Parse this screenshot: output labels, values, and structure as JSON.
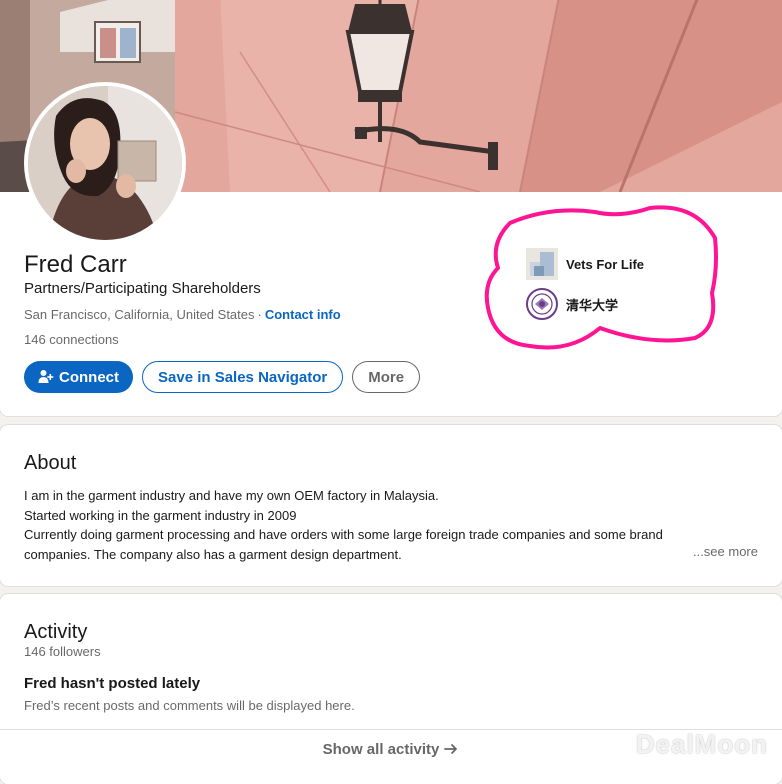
{
  "profile": {
    "name": "Fred Carr",
    "headline": "Partners/Participating Shareholders",
    "location": "San Francisco, California, United States",
    "separator": "·",
    "contact_info": "Contact info",
    "connections": "146 connections"
  },
  "actions": {
    "connect": "Connect",
    "save_sales_navigator": "Save in Sales Navigator",
    "more": "More"
  },
  "orgs": [
    {
      "name": "Vets For Life",
      "icon": "company-logo-icon"
    },
    {
      "name": "清华大学",
      "icon": "university-seal-icon"
    }
  ],
  "about": {
    "title": "About",
    "lines": [
      "I am in the garment industry and have my own OEM factory in Malaysia.",
      "Started working in the garment industry in 2009",
      "Currently doing garment processing and have orders with some large foreign trade companies and some brand",
      "companies. The company also has a garment design department."
    ],
    "see_more": "...see more"
  },
  "activity": {
    "title": "Activity",
    "followers": "146 followers",
    "no_posts_title": "Fred hasn't posted lately",
    "no_posts_desc": "Fred’s recent posts and comments will be displayed here.",
    "show_all": "Show all activity"
  },
  "watermark": "DealMoon",
  "colors": {
    "primary": "#0a66c2",
    "highlight": "#ff1493",
    "background": "#f3f2ef"
  }
}
